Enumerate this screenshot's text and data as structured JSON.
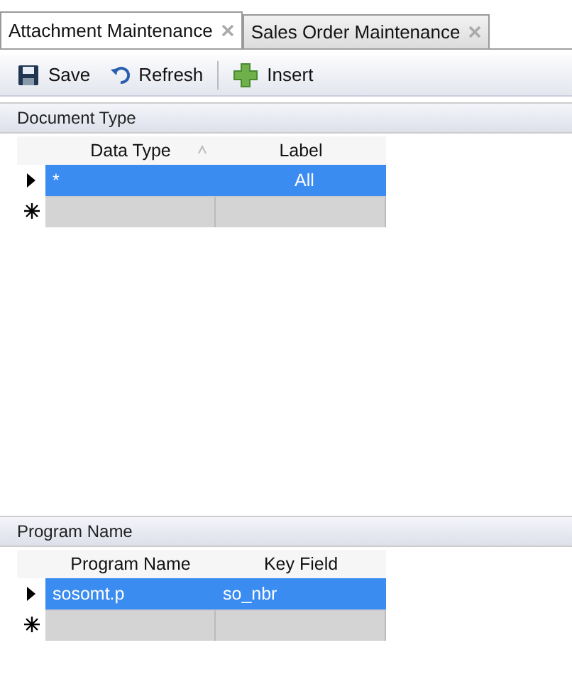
{
  "tabs": [
    {
      "label": "Attachment Maintenance",
      "selected": true
    },
    {
      "label": "Sales Order Maintenance",
      "selected": false
    }
  ],
  "toolbar": [
    {
      "kind": "save",
      "label": "Save"
    },
    {
      "kind": "refresh",
      "label": "Refresh"
    },
    {
      "kind": "separator"
    },
    {
      "kind": "insert",
      "label": "Insert"
    }
  ],
  "sections": [
    {
      "title": "Document Type",
      "columns": [
        {
          "label": "Data Type",
          "sorted": true
        },
        {
          "label": "Label",
          "sorted": false
        }
      ],
      "rows": [
        {
          "cells": [
            "*",
            "All"
          ],
          "selected": true
        }
      ],
      "new_row": true
    },
    {
      "title": "Program Name",
      "columns": [
        {
          "label": "Program Name",
          "sorted": false
        },
        {
          "label": "Key Field",
          "sorted": false
        }
      ],
      "rows": [
        {
          "cells": [
            "sosomt.p",
            "so_nbr"
          ],
          "selected": true
        }
      ],
      "new_row": true
    }
  ]
}
